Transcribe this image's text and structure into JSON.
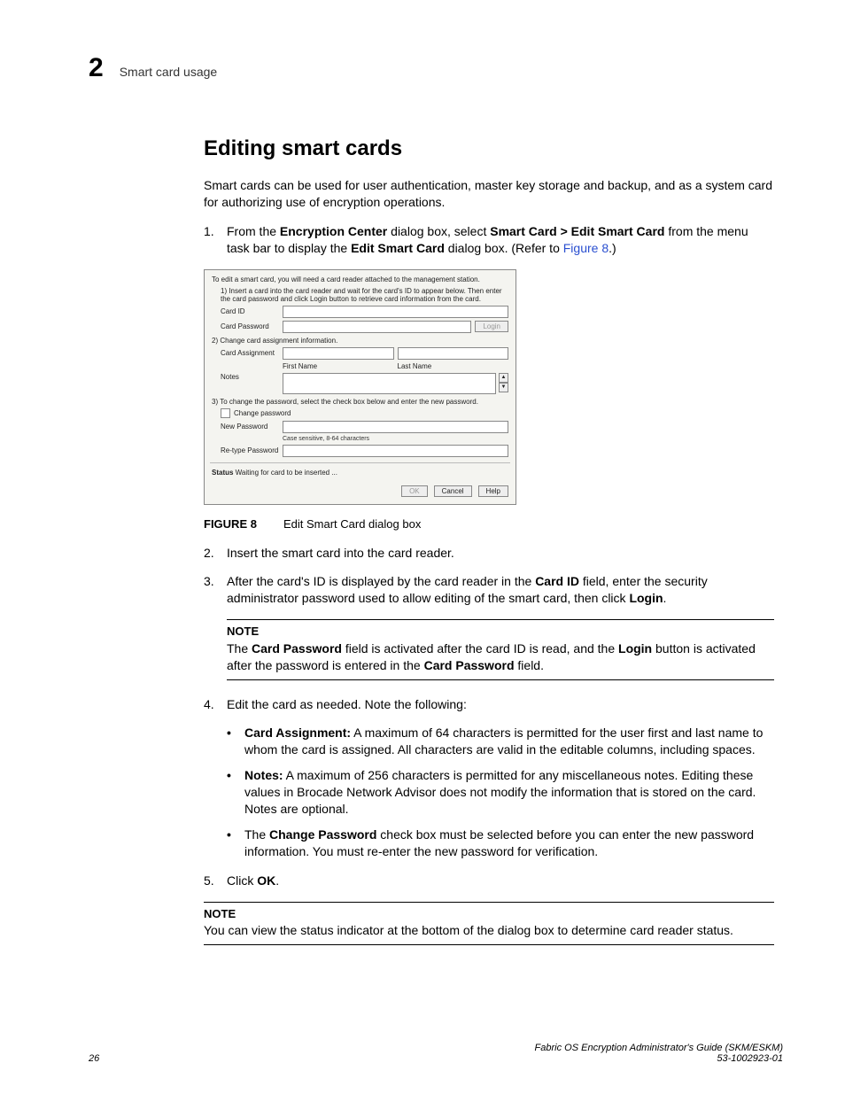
{
  "header": {
    "chapter_number": "2",
    "running_title": "Smart card usage"
  },
  "section_title": "Editing smart cards",
  "intro": "Smart cards can be used for user authentication, master key storage and backup, and as a system card for authorizing use of encryption operations.",
  "step1": {
    "num": "1.",
    "pre": "From the ",
    "b1": "Encryption Center",
    "mid1": " dialog box, select ",
    "b2": "Smart Card > Edit Smart Card",
    "mid2": " from the menu task bar to display the ",
    "b3": "Edit Smart Card",
    "mid3": " dialog box. (Refer to ",
    "link": "Figure 8",
    "end": ".)"
  },
  "dialog": {
    "top": "To edit a smart card, you will need a card reader attached to the management station.",
    "s1": "1) Insert a card into the card reader and wait for the card's ID to appear below. Then enter the card password and click Login button to retrieve card information from the card.",
    "card_id": "Card ID",
    "card_pw": "Card Password",
    "login": "Login",
    "s2": "2) Change card assignment information.",
    "card_assign": "Card Assignment",
    "first_name": "First Name",
    "last_name": "Last Name",
    "notes": "Notes",
    "s3": "3) To change the password, select the check box below and enter the new password.",
    "change_pw": "Change password",
    "new_pw": "New Password",
    "hint": "Case sensitive, 8-64 characters",
    "retype": "Re-type Password",
    "status_lbl": "Status",
    "status_txt": " Waiting for card to be inserted ...",
    "ok": "OK",
    "cancel": "Cancel",
    "help": "Help"
  },
  "caption": {
    "label": "FIGURE 8",
    "text": "Edit Smart Card dialog box"
  },
  "step2": {
    "num": "2.",
    "text": "Insert the smart card into the card reader."
  },
  "step3": {
    "num": "3.",
    "pre": "After the card's ID is displayed by the card reader in the ",
    "b1": "Card ID",
    "mid1": " field, enter the security administrator password used to allow editing of the smart card, then click ",
    "b2": "Login",
    "end": "."
  },
  "note1": {
    "head": "NOTE",
    "pre": "The ",
    "b1": "Card Password",
    "mid1": " field is activated after the card ID is read, and the ",
    "b2": "Login",
    "mid2": " button is activated after the password is entered in the ",
    "b3": "Card Password",
    "end": " field."
  },
  "step4": {
    "num": "4.",
    "text": "Edit the card as needed. Note the following:"
  },
  "bullets": {
    "a": {
      "b": "Card Assignment:",
      "t": " A maximum of 64 characters is permitted for the user first and last name to whom the card is assigned. All characters are valid in the editable columns, including spaces."
    },
    "b": {
      "b": "Notes:",
      "t": " A maximum of 256 characters is permitted for any miscellaneous notes. Editing these values in Brocade Network Advisor does not modify the information that is stored on the card. Notes are optional."
    },
    "c": {
      "pre": "The ",
      "b": "Change Password",
      "t": " check box must be selected before you can enter the new password information. You must re-enter the new password for verification."
    }
  },
  "step5": {
    "num": "5.",
    "pre": "Click ",
    "b": "OK",
    "end": "."
  },
  "note2": {
    "head": "NOTE",
    "text": "You can view the status indicator at the bottom of the dialog box to determine card reader status."
  },
  "footer": {
    "page": "26",
    "title": "Fabric OS Encryption Administrator's Guide (SKM/ESKM)",
    "docnum": "53-1002923-01"
  }
}
